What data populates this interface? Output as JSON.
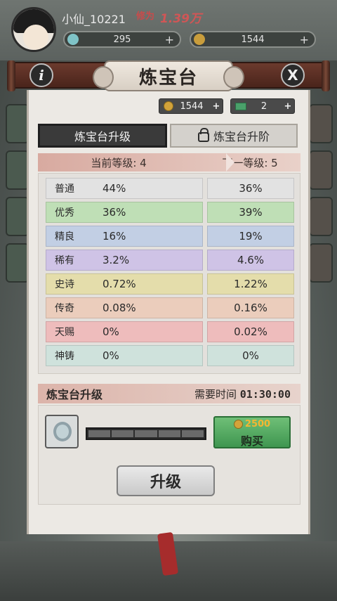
{
  "header": {
    "username": "小仙_10221",
    "power_label": "修为",
    "power_value": "1.39万",
    "res1_value": "295",
    "res2_value": "1544"
  },
  "dialog": {
    "title": "炼宝台",
    "info_label": "i",
    "close_label": "X",
    "currency": {
      "coins": "1544",
      "tickets": "2"
    },
    "tabs": [
      {
        "label": "炼宝台升级",
        "active": true
      },
      {
        "label": "炼宝台升阶",
        "active": false
      }
    ],
    "current_level_label": "当前等级: 4",
    "next_level_label": "下一等级: 5",
    "rates": [
      {
        "name": "普通",
        "current": "44%",
        "next": "36%",
        "color": "#e2e2e2"
      },
      {
        "name": "优秀",
        "current": "36%",
        "next": "39%",
        "color": "#bfdfb6"
      },
      {
        "name": "精良",
        "current": "16%",
        "next": "19%",
        "color": "#c2cfe4"
      },
      {
        "name": "稀有",
        "current": "3.2%",
        "next": "4.6%",
        "color": "#cfc3e6"
      },
      {
        "name": "史诗",
        "current": "0.72%",
        "next": "1.22%",
        "color": "#e4ddab"
      },
      {
        "name": "传奇",
        "current": "0.08%",
        "next": "0.16%",
        "color": "#ebcdbc"
      },
      {
        "name": "天赐",
        "current": "0%",
        "next": "0.02%",
        "color": "#eebcbc"
      },
      {
        "name": "神铸",
        "current": "0%",
        "next": "0%",
        "color": "#cfe2dc"
      }
    ],
    "upgrade": {
      "section_label": "炼宝台升级",
      "time_label": "需要时间",
      "time_value": "01:30:00",
      "progress_segments": 5,
      "progress_filled": 0,
      "buy_cost": "2500",
      "buy_label": "购买",
      "upgrade_label": "升级"
    }
  }
}
